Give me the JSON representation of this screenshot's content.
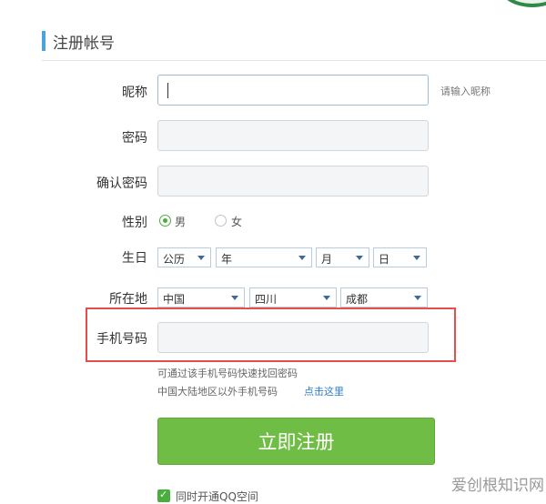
{
  "header": {
    "title": "注册帐号"
  },
  "form": {
    "nickname": {
      "label": "昵称",
      "value": "",
      "hint": "请输入昵称"
    },
    "password": {
      "label": "密码",
      "value": ""
    },
    "confirm_password": {
      "label": "确认密码",
      "value": ""
    },
    "gender": {
      "label": "性别",
      "options": [
        "男",
        "女"
      ],
      "selected": "男"
    },
    "birthday": {
      "label": "生日",
      "calendar": "公历",
      "year": "年",
      "month": "月",
      "day": "日"
    },
    "location": {
      "label": "所在地",
      "country": "中国",
      "province": "四川",
      "city": "成都"
    },
    "phone": {
      "label": "手机号码",
      "value": "",
      "help_line1": "可通过该手机号码快速找回密码",
      "help_line2": "中国大陆地区以外手机号码",
      "help_link": "点击这里"
    },
    "submit_label": "立即注册",
    "qq_space": {
      "label": "同时开通QQ空间",
      "checked": true
    }
  },
  "watermark": "爱创根知识网",
  "colors": {
    "accent_green": "#6fbd45",
    "title_bar": "#4aa3df",
    "highlight": "#e84d4d",
    "link": "#2e7dc8"
  }
}
